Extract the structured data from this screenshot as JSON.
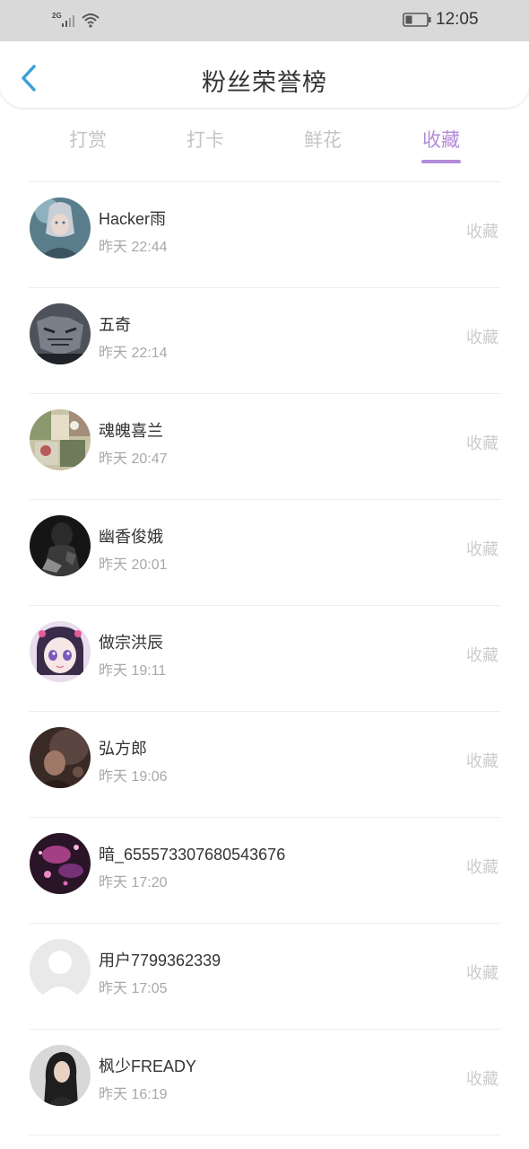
{
  "status_bar": {
    "network": "2G",
    "time": "12:05"
  },
  "header": {
    "title": "粉丝荣誉榜"
  },
  "tabs": [
    {
      "label": "打赏",
      "active": false
    },
    {
      "label": "打卡",
      "active": false
    },
    {
      "label": "鲜花",
      "active": false
    },
    {
      "label": "收藏",
      "active": true
    }
  ],
  "colors": {
    "accent": "#b38bd9",
    "back_arrow": "#3aa0d8",
    "status_bar_bg": "#d9d9d9"
  },
  "fans": [
    {
      "name": "Hacker雨",
      "time": "昨天 22:44",
      "action": "收藏",
      "avatar": "anime-girl-silver-hair"
    },
    {
      "name": "五奇",
      "time": "昨天 22:14",
      "action": "收藏",
      "avatar": "tiger-dark"
    },
    {
      "name": "魂魄喜兰",
      "time": "昨天 20:47",
      "action": "收藏",
      "avatar": "vintage-collage"
    },
    {
      "name": "幽香俊娥",
      "time": "昨天 20:01",
      "action": "收藏",
      "avatar": "dark-figure"
    },
    {
      "name": "做宗洪辰",
      "time": "昨天 19:11",
      "action": "收藏",
      "avatar": "cartoon-girl-purple"
    },
    {
      "name": "弘方郎",
      "time": "昨天 19:06",
      "action": "收藏",
      "avatar": "dark-portrait"
    },
    {
      "name": "暗_655573307680543676",
      "time": "昨天 17:20",
      "action": "收藏",
      "avatar": "purple-sparkle"
    },
    {
      "name": "用户7799362339",
      "time": "昨天 17:05",
      "action": "收藏",
      "avatar": "default-user"
    },
    {
      "name": "枫少FREADY",
      "time": "昨天 16:19",
      "action": "收藏",
      "avatar": "woman-portrait"
    }
  ]
}
